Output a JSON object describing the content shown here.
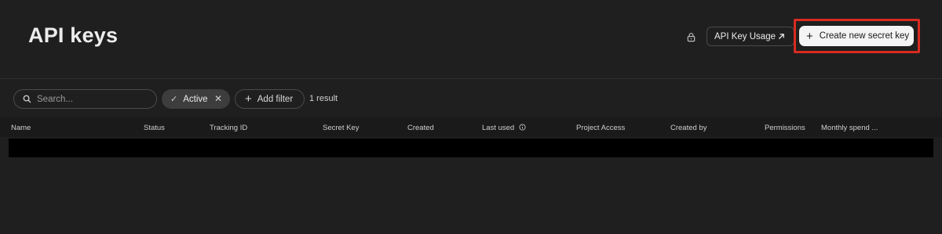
{
  "header": {
    "title": "API keys",
    "usage_button": "API Key Usage",
    "create_button": "Create new secret key"
  },
  "filters": {
    "search_placeholder": "Search...",
    "active_chip": "Active",
    "add_filter": "Add filter",
    "result_count": "1 result"
  },
  "table": {
    "columns": [
      "Name",
      "Status",
      "Tracking ID",
      "Secret Key",
      "Created",
      "Last used",
      "Project Access",
      "Created by",
      "Permissions",
      "Monthly spend ..."
    ]
  },
  "colors": {
    "background": "#1f1f1f",
    "highlight": "#d92a1f",
    "primary_button": "#f4f4f4"
  },
  "icons": [
    "lock-icon",
    "external-arrow-icon",
    "plus-icon",
    "search-icon",
    "check-icon",
    "close-icon",
    "info-icon"
  ]
}
